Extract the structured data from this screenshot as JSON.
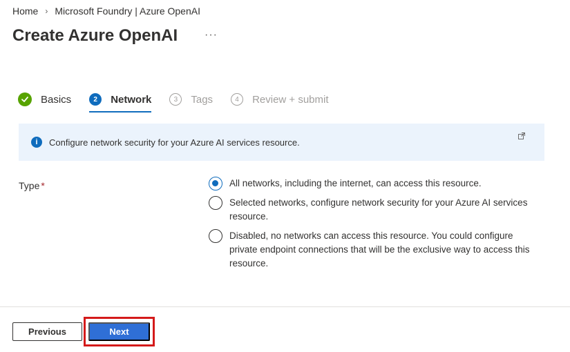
{
  "breadcrumb": {
    "home": "Home",
    "current": "Microsoft Foundry | Azure OpenAI",
    "separator": "›"
  },
  "page": {
    "title": "Create Azure OpenAI",
    "more": "···"
  },
  "steps": [
    {
      "number": "",
      "label": "Basics",
      "state": "done"
    },
    {
      "number": "2",
      "label": "Network",
      "state": "active"
    },
    {
      "number": "3",
      "label": "Tags",
      "state": "pending"
    },
    {
      "number": "4",
      "label": "Review + submit",
      "state": "pending"
    }
  ],
  "info": {
    "text": "Configure network security for your Azure AI services resource."
  },
  "form": {
    "type_label": "Type",
    "required_mark": "*",
    "options": [
      {
        "text": "All networks, including the internet, can access this resource.",
        "checked": true
      },
      {
        "text": "Selected networks, configure network security for your Azure AI services resource.",
        "checked": false
      },
      {
        "text": "Disabled, no networks can access this resource. You could configure private endpoint connections that will be the exclusive way to access this resource.",
        "checked": false
      }
    ]
  },
  "footer": {
    "previous_label": "Previous",
    "next_label": "Next"
  },
  "colors": {
    "accent": "#0f6cbd",
    "success": "#57a300",
    "highlight": "#d41a1a"
  }
}
